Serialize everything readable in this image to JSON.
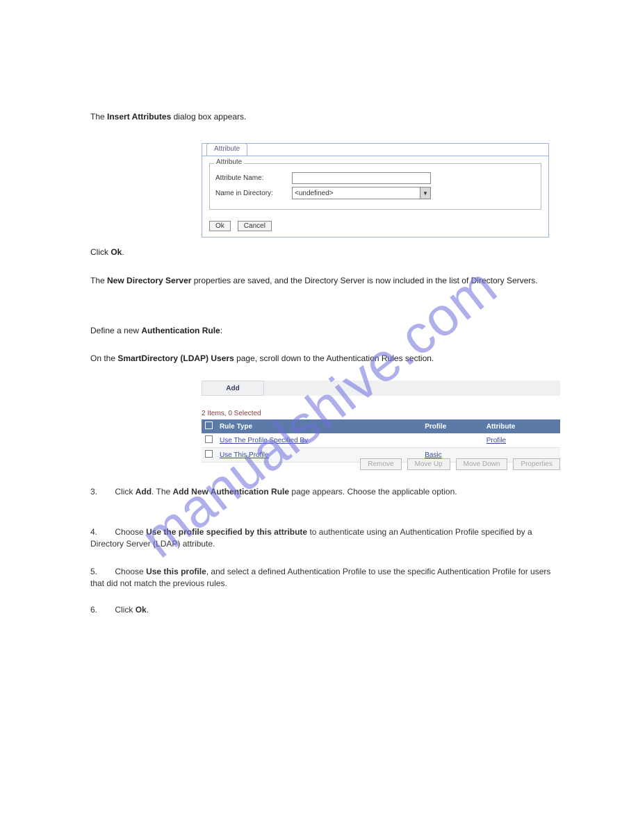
{
  "watermark": "manualshive.com",
  "intro": {
    "line1_prefix": "The ",
    "line1_bold": "Insert Attributes",
    "line1_suffix": " dialog box appears."
  },
  "attr_panel": {
    "tab_label": "Attribute",
    "fieldset_legend": "Attribute",
    "name_label": "Attribute Name:",
    "name_value": "",
    "dir_label": "Name in Directory:",
    "dir_value": "<undefined>",
    "ok_label": "Ok",
    "cancel_label": "Cancel"
  },
  "mid": {
    "click_ok_prefix": "Click ",
    "click_ok_bold": "Ok",
    "click_ok_suffix": ".",
    "saved_text": "The ",
    "saved_bold": "New Directory Server",
    "saved_suffix": " properties are saved, and the Directory Server is now included in the list of Directory Servers.",
    "define_prefix": "Define a new ",
    "define_bold": "Authentication Rule",
    "define_suffix": ":",
    "auth_rules_text": "On the ",
    "auth_rules_bold": "SmartDirectory (LDAP) Users",
    "auth_rules_suffix": " page, scroll down to the Authentication Rules section."
  },
  "add_bar": {
    "add_label": "Add"
  },
  "items_summary": "2 Items, 0 Selected",
  "table": {
    "col_rule": "Rule Type",
    "col_profile": "Profile",
    "col_attribute": "Attribute",
    "rows": [
      {
        "rule": "Use The Profile Specified By",
        "profile": "",
        "attribute": "Profile"
      },
      {
        "rule": "Use This Profile",
        "profile": "Basic",
        "attribute": ""
      }
    ]
  },
  "table_buttons": {
    "remove": "Remove",
    "move_up": "Move Up",
    "move_down": "Move Down",
    "properties": "Properties"
  },
  "steps": {
    "s3_num": "3.",
    "s3_prefix": "Click ",
    "s3_bold": "Add",
    "s3_suffix1": ". The ",
    "s3_bold2": "Add New Authentication Rule",
    "s3_suffix2": " page appears. Choose the applicable option.",
    "s4_num": "4.",
    "s4_prefix": "Choose ",
    "s4_bold": "Use the profile specified by this attribute",
    "s4_suffix": " to authenticate using an Authentication Profile specified by a Directory Server (LDAP) attribute.",
    "s5_num": "5.",
    "s5_prefix": "Choose ",
    "s5_bold": "Use this profile",
    "s5_suffix": ", and select a defined Authentication Profile to use the specific Authentication Profile for users that did not match the previous rules.",
    "s6_num": "6.",
    "s6_prefix": "Click ",
    "s6_bold": "Ok",
    "s6_suffix": "."
  }
}
